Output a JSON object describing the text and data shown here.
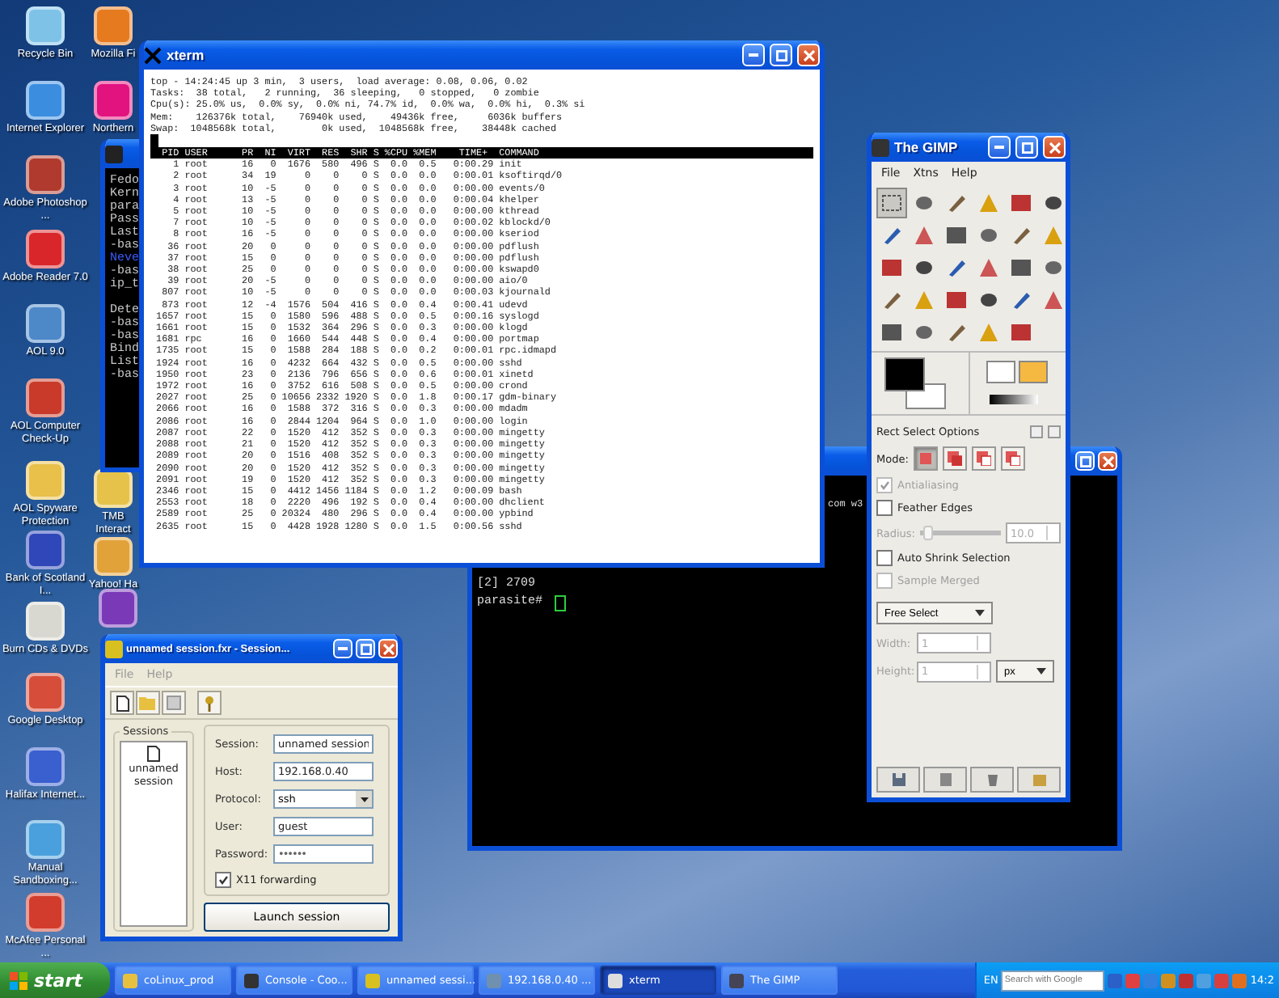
{
  "desktop_icons": [
    {
      "label": "Recycle Bin"
    },
    {
      "label": "Internet Explorer"
    },
    {
      "label": "Adobe Photoshop ..."
    },
    {
      "label": "Adobe Reader 7.0"
    },
    {
      "label": "AOL 9.0"
    },
    {
      "label": "AOL Computer Check-Up"
    },
    {
      "label": "AOL Spyware Protection"
    },
    {
      "label": "Bank of Scotland I..."
    },
    {
      "label": "Burn CDs & DVDs"
    },
    {
      "label": "Google Desktop"
    },
    {
      "label": "Halifax Internet..."
    },
    {
      "label": "Manual Sandboxing..."
    },
    {
      "label": "McAfee Personal ..."
    },
    {
      "label": "Mozilla Fi"
    },
    {
      "label": "Northern"
    },
    {
      "label": "TMB Interact"
    },
    {
      "label": "Yahoo! Ha"
    }
  ],
  "console_window": {
    "blocks": [
      {
        "lines": [
          {
            "text": "Fedo",
            "highlighted": false
          },
          {
            "text": "Kern",
            "highlighted": false
          },
          {
            "text": "para",
            "highlighted": false
          },
          {
            "text": "Pass",
            "highlighted": false
          },
          {
            "text": "Last",
            "highlighted": false
          },
          {
            "text": "-bas",
            "highlighted": false
          },
          {
            "text": "Neve",
            "highlighted": true
          },
          {
            "text": "-bas",
            "highlighted": false
          },
          {
            "text": "ip_t",
            "highlighted": false
          }
        ]
      },
      {
        "lines": [
          {
            "text": "Dete",
            "highlighted": false
          },
          {
            "text": "-bas",
            "highlighted": false
          },
          {
            "text": "-bas",
            "highlighted": false
          },
          {
            "text": "Bind",
            "highlighted": false
          },
          {
            "text": "List",
            "highlighted": false
          },
          {
            "text": "-bas",
            "highlighted": false
          }
        ]
      }
    ]
  },
  "terminal_window": {
    "partial_line": "com w3",
    "job": "[2] 2709",
    "prompt": "parasite#",
    "cursor": true
  },
  "xterm": {
    "title": "xterm",
    "summary": [
      "top - 14:24:45 up 3 min,  3 users,  load average: 0.08, 0.06, 0.02",
      "Tasks:  38 total,   2 running,  36 sleeping,   0 stopped,   0 zombie",
      "Cpu(s): 25.0% us,  0.0% sy,  0.0% ni, 74.7% id,  0.0% wa,  0.0% hi,  0.3% si",
      "Mem:    126376k total,    76940k used,    49436k free,     6036k buffers",
      "Swap:  1048568k total,        0k used,  1048568k free,    38448k cached"
    ],
    "header": "  PID USER      PR  NI  VIRT  RES  SHR S %CPU %MEM    TIME+  COMMAND",
    "processes": [
      "    1 root      16   0  1676  580  496 S  0.0  0.5   0:00.29 init",
      "    2 root      34  19     0    0    0 S  0.0  0.0   0:00.01 ksoftirqd/0",
      "    3 root      10  -5     0    0    0 S  0.0  0.0   0:00.00 events/0",
      "    4 root      13  -5     0    0    0 S  0.0  0.0   0:00.04 khelper",
      "    5 root      10  -5     0    0    0 S  0.0  0.0   0:00.00 kthread",
      "    7 root      10  -5     0    0    0 S  0.0  0.0   0:00.02 kblockd/0",
      "    8 root      16  -5     0    0    0 S  0.0  0.0   0:00.00 kseriod",
      "   36 root      20   0     0    0    0 S  0.0  0.0   0:00.00 pdflush",
      "   37 root      15   0     0    0    0 S  0.0  0.0   0:00.00 pdflush",
      "   38 root      25   0     0    0    0 S  0.0  0.0   0:00.00 kswapd0",
      "   39 root      20  -5     0    0    0 S  0.0  0.0   0:00.00 aio/0",
      "  807 root      10  -5     0    0    0 S  0.0  0.0   0:00.03 kjournald",
      "  873 root      12  -4  1576  504  416 S  0.0  0.4   0:00.41 udevd",
      " 1657 root      15   0  1580  596  488 S  0.0  0.5   0:00.16 syslogd",
      " 1661 root      15   0  1532  364  296 S  0.0  0.3   0:00.00 klogd",
      " 1681 rpc       16   0  1660  544  448 S  0.0  0.4   0:00.00 portmap",
      " 1735 root      15   0  1588  284  188 S  0.0  0.2   0:00.01 rpc.idmapd",
      " 1924 root      16   0  4232  664  432 S  0.0  0.5   0:00.00 sshd",
      " 1950 root      23   0  2136  796  656 S  0.0  0.6   0:00.01 xinetd",
      " 1972 root      16   0  3752  616  508 S  0.0  0.5   0:00.00 crond",
      " 2027 root      25   0 10656 2332 1920 S  0.0  1.8   0:00.17 gdm-binary",
      " 2066 root      16   0  1588  372  316 S  0.0  0.3   0:00.00 mdadm",
      " 2086 root      16   0  2844 1204  964 S  0.0  1.0   0:00.00 login",
      " 2087 root      22   0  1520  412  352 S  0.0  0.3   0:00.00 mingetty",
      " 2088 root      21   0  1520  412  352 S  0.0  0.3   0:00.00 mingetty",
      " 2089 root      20   0  1516  408  352 S  0.0  0.3   0:00.00 mingetty",
      " 2090 root      20   0  1520  412  352 S  0.0  0.3   0:00.00 mingetty",
      " 2091 root      19   0  1520  412  352 S  0.0  0.3   0:00.00 mingetty",
      " 2346 root      15   0  4412 1456 1184 S  0.0  1.2   0:00.09 bash",
      " 2553 root      18   0  2220  496  192 S  0.0  0.4   0:00.00 dhclient",
      " 2589 root      25   0 20324  480  296 S  0.0  0.4   0:00.00 ypbind",
      " 2635 root      15   0  4428 1928 1280 S  0.0  1.5   0:00.56 sshd"
    ]
  },
  "gimp": {
    "title": "The GIMP",
    "menu": [
      "File",
      "Xtns",
      "Help"
    ],
    "tools": [
      {
        "selected": true
      },
      {
        "selected": false
      },
      {
        "selected": false
      },
      {
        "selected": false
      },
      {
        "selected": false
      },
      {
        "selected": false
      },
      {
        "selected": false
      },
      {
        "selected": false
      },
      {
        "selected": false
      },
      {
        "selected": false
      },
      {
        "selected": false
      },
      {
        "selected": false
      },
      {
        "selected": false
      },
      {
        "selected": false
      },
      {
        "selected": false
      },
      {
        "selected": false
      },
      {
        "selected": false
      },
      {
        "selected": false
      },
      {
        "selected": false
      },
      {
        "selected": false
      },
      {
        "selected": false
      },
      {
        "selected": false
      },
      {
        "selected": false
      },
      {
        "selected": false
      },
      {
        "selected": false
      },
      {
        "selected": false
      },
      {
        "selected": false
      },
      {
        "selected": false
      },
      {
        "selected": false
      }
    ],
    "options_title": "Rect Select Options",
    "mode_label": "Mode:",
    "modes": [
      {
        "selected": true
      },
      {
        "selected": false
      },
      {
        "selected": false
      },
      {
        "selected": false
      }
    ],
    "options": [
      {
        "kind": "checkbox",
        "label": "Antialiasing",
        "checked": true,
        "disabled": true
      },
      {
        "kind": "checkbox",
        "label": "Feather Edges",
        "checked": false,
        "disabled": false
      },
      {
        "kind": "slider",
        "label": "Radius:",
        "value": "10.0",
        "level": 0.1,
        "disabled": true
      },
      {
        "kind": "checkbox",
        "label": "Auto Shrink Selection",
        "checked": false,
        "disabled": false
      },
      {
        "kind": "checkbox",
        "label": "Sample Merged",
        "checked": false,
        "disabled": true
      }
    ],
    "select_mode": "Free Select",
    "sizes": [
      {
        "label": "Width:",
        "value": "1"
      },
      {
        "label": "Height:",
        "value": "1"
      }
    ],
    "unit": "px"
  },
  "session": {
    "title": "unnamed session.fxr - Session...",
    "menu": [
      "File",
      "Help"
    ],
    "sessions_label": "Sessions",
    "sessions": [
      "unnamed session"
    ],
    "fields": [
      {
        "kind": "text",
        "label": "Session:",
        "value": "unnamed session"
      },
      {
        "kind": "text",
        "label": "Host:",
        "value": "192.168.0.40"
      },
      {
        "kind": "select",
        "label": "Protocol:",
        "value": "ssh"
      },
      {
        "kind": "text",
        "label": "User:",
        "value": "guest"
      },
      {
        "kind": "password",
        "label": "Password:",
        "value": "••••••"
      }
    ],
    "x11_forwarding": {
      "label": "X11 forwarding",
      "checked": true
    },
    "launch_button": "Launch session"
  },
  "taskbar": {
    "start": "start",
    "tasks": [
      {
        "label": "coLinux_prod",
        "selected": false
      },
      {
        "label": "Console - Coo...",
        "selected": false
      },
      {
        "label": "unnamed sessi...",
        "selected": false
      },
      {
        "label": "192.168.0.40 ...",
        "selected": false
      },
      {
        "label": "xterm",
        "selected": true
      },
      {
        "label": "The GIMP",
        "selected": false
      }
    ],
    "language": "EN",
    "search_placeholder": "Search with Google",
    "clock": "14:2"
  }
}
